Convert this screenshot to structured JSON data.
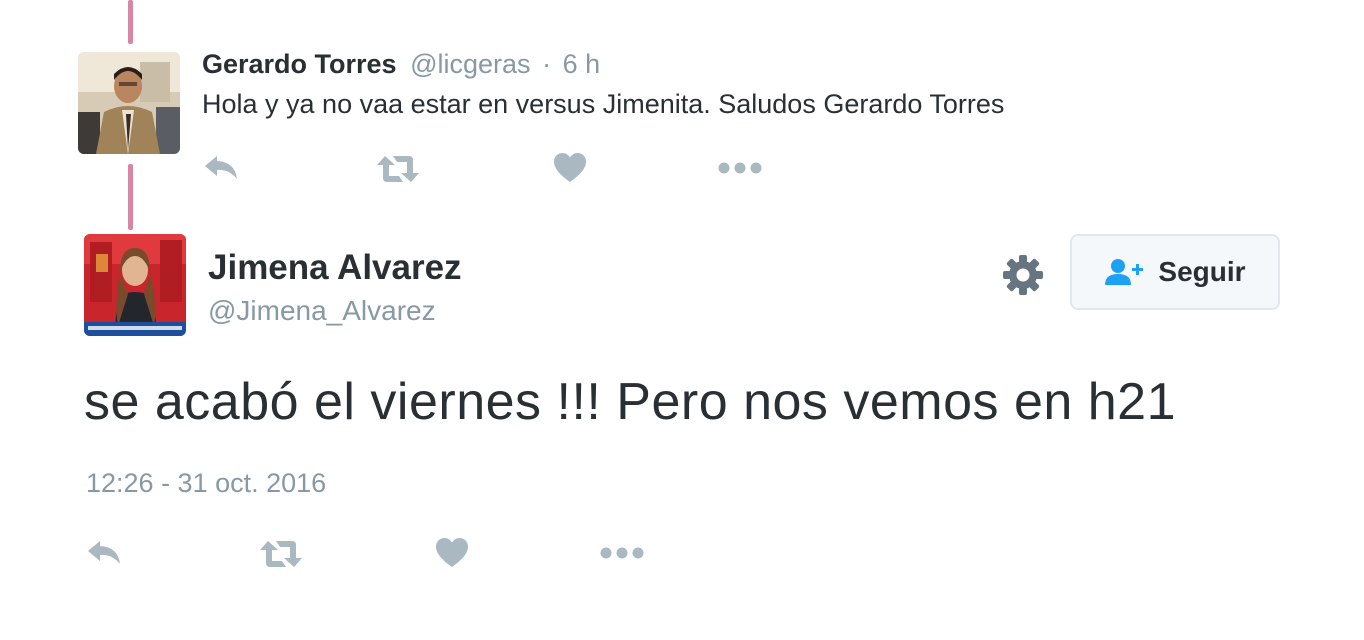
{
  "reply": {
    "name": "Gerardo Torres",
    "handle": "@licgeras",
    "separator": "·",
    "time": "6 h",
    "text": "Hola y ya no vaa estar en versus Jimenita. Saludos Gerardo Torres",
    "actions": [
      "reply-icon",
      "retweet-icon",
      "heart-icon",
      "more-icon"
    ]
  },
  "tweet": {
    "name": "Jimena Alvarez",
    "handle": "@Jimena_Alvarez",
    "text": "se acabó el viernes !!! Pero nos vemos en h21",
    "date": "12:26 - 31 oct. 2016",
    "follow_label": "Seguir",
    "actions": [
      "reply-icon",
      "retweet-icon",
      "heart-icon",
      "more-icon"
    ]
  },
  "colors": {
    "thread_line": "#d985a5",
    "icon_gray": "#aab8c2",
    "meta_gray": "#8899a6",
    "text_dark": "#292f33",
    "follow_icon_blue": "#1da1f2"
  }
}
